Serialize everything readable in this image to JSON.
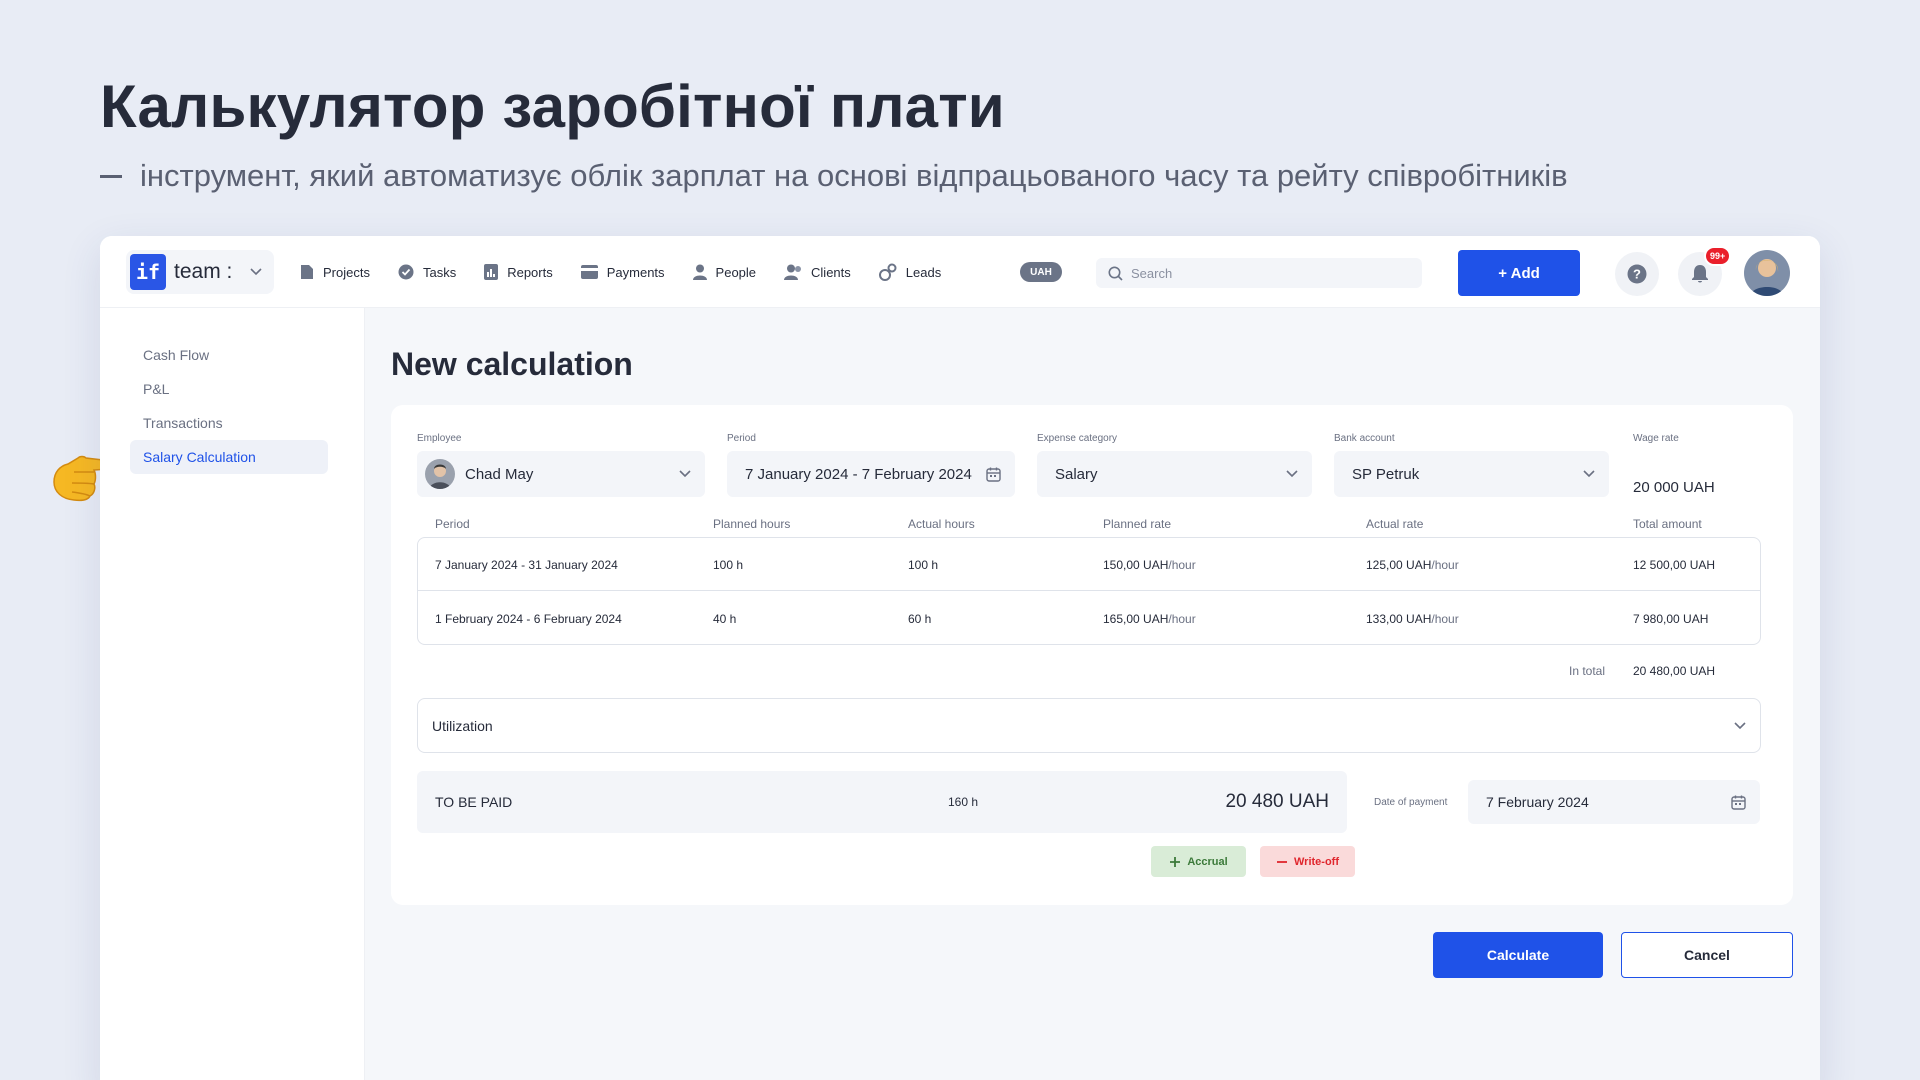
{
  "slide": {
    "title": "Калькулятор заробітної плати",
    "subtitle": "інструмент, який автоматизує облік зарплат на основі відпрацьованого часу та рейту співробітників"
  },
  "app": {
    "brand": "team :",
    "brand_logo": "if",
    "nav": [
      "Projects",
      "Tasks",
      "Reports",
      "Payments",
      "People",
      "Clients",
      "Leads"
    ],
    "currency_pill": "UAH",
    "search_placeholder": "Search",
    "add_button": "+ Add",
    "notification_badge": "99+"
  },
  "sidebar": {
    "items": [
      "Cash Flow",
      "P&L",
      "Transactions",
      "Salary Calculation"
    ],
    "active": "Salary Calculation"
  },
  "form": {
    "page_title": "New calculation",
    "employee": {
      "label": "Employee",
      "value": "Chad May"
    },
    "period": {
      "label": "Period",
      "value": "7 January 2024 - 7 February 2024"
    },
    "expense_category": {
      "label": "Expense category",
      "value": "Salary"
    },
    "bank_account": {
      "label": "Bank account",
      "value": "SP Petruk"
    },
    "wage_rate": {
      "label": "Wage rate",
      "value": "20 000 UAH"
    }
  },
  "table": {
    "headers": [
      "Period",
      "Planned hours",
      "Actual hours",
      "Planned rate",
      "Actual rate",
      "Total amount"
    ],
    "rate_unit": "/hour",
    "rows": [
      {
        "period": "7 January 2024 - 31 January 2024",
        "planned_hours": "100 h",
        "actual_hours": "100 h",
        "planned_rate": "150,00 UAH",
        "actual_rate": "125,00 UAH",
        "total": "12 500,00 UAH"
      },
      {
        "period": "1 February 2024 - 6 February 2024",
        "planned_hours": "40 h",
        "actual_hours": "60 h",
        "planned_rate": "165,00 UAH",
        "actual_rate": "133,00 UAH",
        "total": "7 980,00 UAH"
      }
    ],
    "total_label": "In total",
    "total_value": "20 480,00 UAH"
  },
  "utilization": {
    "label": "Utilization"
  },
  "payment": {
    "label": "TO BE PAID",
    "hours": "160 h",
    "amount": "20 480 UAH",
    "date_label": "Date of payment",
    "date_value": "7 February 2024"
  },
  "actions": {
    "accrual": "Accrual",
    "writeoff": "Write-off",
    "calculate": "Calculate",
    "cancel": "Cancel"
  },
  "colors": {
    "primary": "#1f52e8",
    "accrual_bg": "#d9ecd7",
    "writeoff_bg": "#fadada",
    "badge": "#ea1f2b"
  }
}
